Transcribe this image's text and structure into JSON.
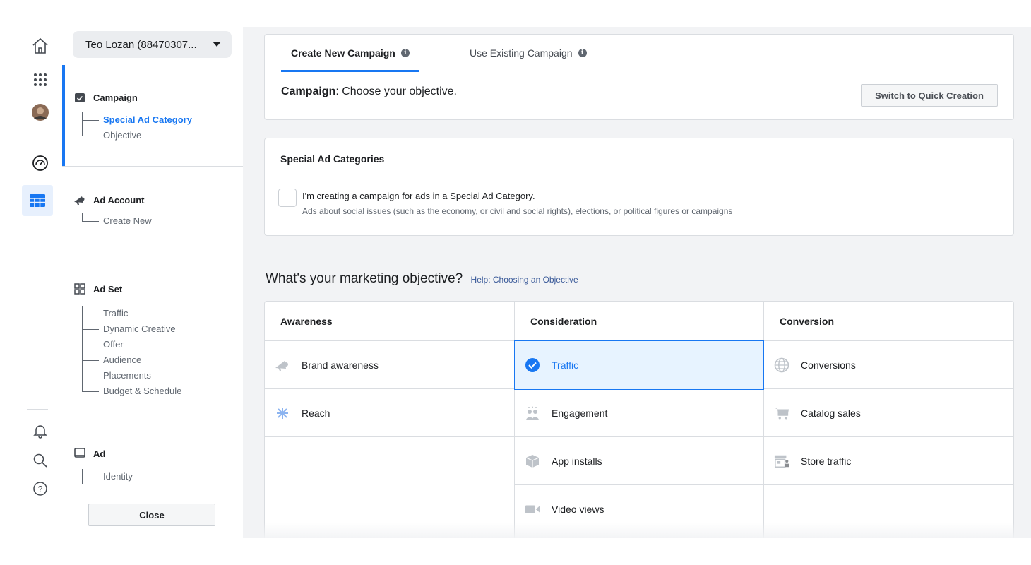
{
  "rail": {
    "icons": [
      "home-icon",
      "apps-grid-icon",
      "profile-avatar",
      "dashboard-gauge-icon",
      "ads-manager-table-icon",
      "notifications-bell-icon",
      "search-icon",
      "help-icon"
    ]
  },
  "sidebar": {
    "account_select": "Teo Lozan (88470307...",
    "steps": [
      {
        "label": "Campaign",
        "icon": "campaign-checkbox-icon",
        "substeps": [
          "Special Ad Category",
          "Objective"
        ],
        "active_substep": "Special Ad Category"
      },
      {
        "label": "Ad Account",
        "icon": "megaphone-icon",
        "substeps": [
          "Create New"
        ]
      },
      {
        "label": "Ad Set",
        "icon": "ad-set-grid-icon",
        "substeps": [
          "Traffic",
          "Dynamic Creative",
          "Offer",
          "Audience",
          "Placements",
          "Budget & Schedule"
        ]
      },
      {
        "label": "Ad",
        "icon": "ad-square-icon",
        "substeps": [
          "Identity"
        ]
      }
    ],
    "close_label": "Close"
  },
  "main": {
    "tabs": [
      {
        "label": "Create New Campaign",
        "active": true
      },
      {
        "label": "Use Existing Campaign",
        "active": false
      }
    ],
    "campaign_label": "Campaign",
    "campaign_text": ": Choose your objective.",
    "switch_label": "Switch to Quick Creation",
    "special_ad": {
      "title": "Special Ad Categories",
      "checkbox_label": "I'm creating a campaign for ads in a Special Ad Category.",
      "description": "Ads about social issues (such as the economy, or civil and social rights), elections, or political figures or campaigns",
      "checked": false
    },
    "objective_title": "What's your marketing objective?",
    "objective_help": "Help: Choosing an Objective",
    "columns": [
      {
        "title": "Awareness",
        "items": [
          {
            "label": "Brand awareness",
            "icon": "megaphone-icon"
          },
          {
            "label": "Reach",
            "icon": "reach-icon"
          }
        ]
      },
      {
        "title": "Consideration",
        "items": [
          {
            "label": "Traffic",
            "icon": "check-circle-icon",
            "selected": true
          },
          {
            "label": "Engagement",
            "icon": "people-icon"
          },
          {
            "label": "App installs",
            "icon": "box-icon"
          },
          {
            "label": "Video views",
            "icon": "video-camera-icon"
          }
        ]
      },
      {
        "title": "Conversion",
        "items": [
          {
            "label": "Conversions",
            "icon": "globe-icon"
          },
          {
            "label": "Catalog sales",
            "icon": "cart-icon"
          },
          {
            "label": "Store traffic",
            "icon": "store-icon"
          }
        ]
      }
    ]
  },
  "colors": {
    "accent": "#1877f2",
    "selected_bg": "#e7f3ff",
    "panel_bg": "#f2f3f5",
    "border": "#dadde1",
    "muted": "#606770",
    "link": "#385898"
  }
}
